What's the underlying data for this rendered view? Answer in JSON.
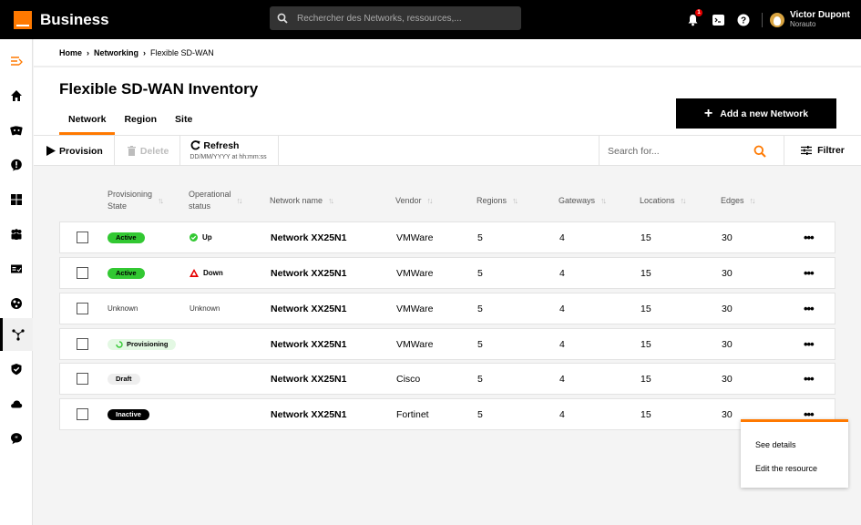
{
  "app": {
    "brand": "Business",
    "brand_color": "#ff7900"
  },
  "topbar": {
    "search_placeholder": "Rechercher des Networks, ressources,...",
    "notification_count": "1",
    "icons": [
      "bell-icon",
      "terminal-icon",
      "help-icon"
    ],
    "user": {
      "name": "Victor Dupont",
      "org": "Norauto"
    }
  },
  "sidebar": {
    "items": [
      {
        "name": "menu-toggle",
        "icon": "menu-expand-icon",
        "active": false
      },
      {
        "name": "home",
        "icon": "home-icon",
        "active": false
      },
      {
        "name": "tickets",
        "icon": "tickets-icon",
        "active": false
      },
      {
        "name": "alerts",
        "icon": "alert-icon",
        "active": false
      },
      {
        "name": "dashboard",
        "icon": "grid-icon",
        "active": false
      },
      {
        "name": "users",
        "icon": "users-icon",
        "active": false
      },
      {
        "name": "billing",
        "icon": "card-icon",
        "active": false
      },
      {
        "name": "internet",
        "icon": "globe-icon",
        "active": false
      },
      {
        "name": "networking",
        "icon": "network-icon",
        "active": true
      },
      {
        "name": "security",
        "icon": "shield-icon",
        "active": false
      },
      {
        "name": "cloud",
        "icon": "cloud-icon",
        "active": false
      },
      {
        "name": "feedback",
        "icon": "chat-icon",
        "active": false
      }
    ]
  },
  "breadcrumb": {
    "items": [
      "Home",
      "Networking",
      "Flexible SD-WAN"
    ]
  },
  "page": {
    "title": "Flexible SD-WAN Inventory",
    "tabs": [
      {
        "label": "Network",
        "active": true
      },
      {
        "label": "Region",
        "active": false
      },
      {
        "label": "Site",
        "active": false
      }
    ],
    "add_button": "Add a new Network"
  },
  "toolbar": {
    "provision": "Provision",
    "delete": "Delete",
    "refresh": "Refresh",
    "refresh_timestamp": "DD/MM/YYYY at hh:mm:ss",
    "search_placeholder": "Search for...",
    "filter": "Filtrer"
  },
  "table": {
    "columns": [
      "Provisioning State",
      "Operational status",
      "Network name",
      "Vendor",
      "Regions",
      "Gateways",
      "Locations",
      "Edges"
    ],
    "columns_split": [
      [
        "Provisioning",
        "State"
      ],
      [
        "Operational",
        "status"
      ]
    ],
    "rows": [
      {
        "prov_state": "Active",
        "prov_type": "active",
        "op_status": "Up",
        "op_type": "up",
        "name": "Network XX25N1",
        "vendor": "VMWare",
        "regions": "5",
        "gateways": "4",
        "locations": "15",
        "edges": "30"
      },
      {
        "prov_state": "Active",
        "prov_type": "active",
        "op_status": "Down",
        "op_type": "down",
        "name": "Network XX25N1",
        "vendor": "VMWare",
        "regions": "5",
        "gateways": "4",
        "locations": "15",
        "edges": "30"
      },
      {
        "prov_state": "Unknown",
        "prov_type": "plain",
        "op_status": "Unknown",
        "op_type": "plain",
        "name": "Network XX25N1",
        "vendor": "VMWare",
        "regions": "5",
        "gateways": "4",
        "locations": "15",
        "edges": "30"
      },
      {
        "prov_state": "Provisioning",
        "prov_type": "provisioning",
        "op_status": "",
        "op_type": "none",
        "name": "Network XX25N1",
        "vendor": "VMWare",
        "regions": "5",
        "gateways": "4",
        "locations": "15",
        "edges": "30"
      },
      {
        "prov_state": "Draft",
        "prov_type": "draft",
        "op_status": "",
        "op_type": "none",
        "name": "Network XX25N1",
        "vendor": "Cisco",
        "regions": "5",
        "gateways": "4",
        "locations": "15",
        "edges": "30"
      },
      {
        "prov_state": "Inactive",
        "prov_type": "inactive",
        "op_status": "",
        "op_type": "none",
        "name": "Network XX25N1",
        "vendor": "Fortinet",
        "regions": "5",
        "gateways": "4",
        "locations": "15",
        "edges": "30"
      }
    ]
  },
  "context_menu": {
    "items": [
      "See details",
      "Edit the resource"
    ]
  },
  "colors": {
    "accent": "#ff7900",
    "active": "#32c832",
    "up": "#32c832",
    "down": "#e70000"
  }
}
